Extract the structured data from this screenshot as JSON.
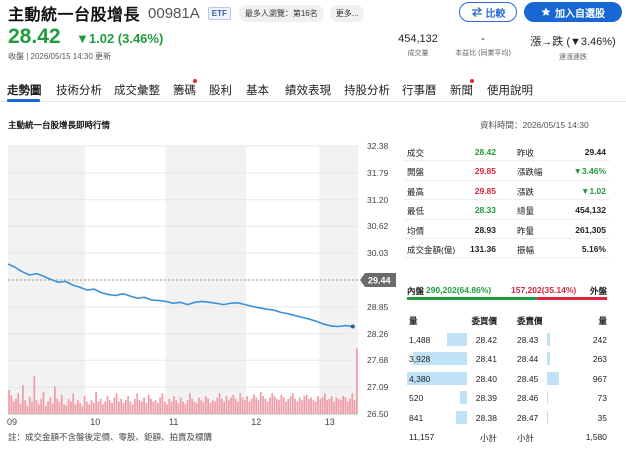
{
  "header": {
    "name": "主動統一台股增長",
    "code": "00981A",
    "etf_tag": "ETF",
    "rank_tag": "最多人瀏覽：第16名",
    "more_tag": "更多...",
    "compare_label": "比較",
    "watch_label": "加入自選股",
    "price": "28.42",
    "change": "▼1.02 (3.46%)",
    "timestamp": "收盤 | 2026/05/15 14:30 更新",
    "stats": [
      {
        "value": "454,132",
        "label": "成交量"
      },
      {
        "value": "-",
        "label": "本益比 (同業平均)"
      },
      {
        "value": "漲→跌 (▼3.46%)",
        "label": "連漲連跌"
      }
    ]
  },
  "tabs": [
    "走勢圖",
    "技術分析",
    "成交彙整",
    "籌碼",
    "股利",
    "基本",
    "績效表現",
    "持股分析",
    "行事曆",
    "新聞",
    "使用說明"
  ],
  "section_title": "主動統一台股增長即時行情",
  "data_time": "資料時間：2026/05/15 14:30",
  "footnote": "註：成交金額不含盤後定價、零股、鉅額、拍賣及標購",
  "colors": {
    "up": "#d7263d",
    "down": "#1f9c3d",
    "line": "#3d8fd8",
    "accent": "#1967d2",
    "volume": "#ef9aa5"
  },
  "chart_data": {
    "type": "line",
    "title": "",
    "x_ticks": [
      "09",
      "10",
      "11",
      "12",
      "13"
    ],
    "y_ticks": [
      "32.38",
      "31.79",
      "31.20",
      "30.62",
      "30.03",
      "29.44",
      "28.85",
      "28.26",
      "27.68",
      "27.09",
      "26.50"
    ],
    "ylim": [
      26.5,
      32.38
    ],
    "reference_price": 29.44,
    "reference_label": "29.44",
    "series": [
      {
        "values": [
          29.79,
          29.72,
          29.62,
          29.55,
          29.58,
          29.52,
          29.45,
          29.39,
          29.41,
          29.33,
          29.28,
          29.22,
          29.24,
          29.16,
          29.12,
          29.1,
          29.14,
          29.09,
          29.04,
          29.06,
          29.0,
          28.99,
          28.97,
          28.93,
          28.95,
          28.9,
          28.95,
          28.97,
          28.95,
          28.93,
          28.9,
          28.93,
          28.94,
          28.9,
          28.86,
          28.83,
          28.8,
          28.78,
          28.73,
          28.7,
          28.66,
          28.62,
          28.58,
          28.53,
          28.47,
          28.43,
          28.42,
          28.44,
          28.42
        ]
      }
    ],
    "volume": [
      0.35,
      0.27,
      0.18,
      0.22,
      0.3,
      0.15,
      0.42,
      0.2,
      0.12,
      0.25,
      0.18,
      0.55,
      0.2,
      0.14,
      0.22,
      0.32,
      0.12,
      0.18,
      0.24,
      0.15,
      0.4,
      0.22,
      0.18,
      0.28,
      0.14,
      0.12,
      0.22,
      0.18,
      0.3,
      0.14,
      0.2,
      0.16,
      0.12,
      0.26,
      0.18,
      0.14,
      0.2,
      0.16,
      0.32,
      0.18,
      0.22,
      0.14,
      0.18,
      0.26,
      0.2,
      0.16,
      0.24,
      0.3,
      0.18,
      0.22,
      0.16,
      0.2,
      0.26,
      0.18,
      0.14,
      0.22,
      0.3,
      0.2,
      0.18,
      0.24,
      0.16,
      0.28,
      0.22,
      0.18,
      0.2,
      0.16,
      0.24,
      0.3,
      0.18,
      0.14,
      0.22,
      0.18,
      0.26,
      0.2,
      0.16,
      0.24,
      0.18,
      0.14,
      0.2,
      0.3,
      0.22,
      0.18,
      0.16,
      0.24,
      0.2,
      0.18,
      0.26,
      0.22,
      0.16,
      0.2,
      0.18,
      0.24,
      0.3,
      0.22,
      0.18,
      0.26,
      0.2,
      0.24,
      0.28,
      0.22,
      0.18,
      0.3,
      0.24,
      0.2,
      0.26,
      0.18,
      0.22,
      0.28,
      0.24,
      0.2,
      0.32,
      0.26,
      0.22,
      0.18,
      0.24,
      0.3,
      0.26,
      0.22,
      0.2,
      0.28,
      0.24,
      0.18,
      0.22,
      0.26,
      0.3,
      0.22,
      0.18,
      0.24,
      0.2,
      0.26,
      0.28,
      0.22,
      0.24,
      0.2,
      0.18,
      0.26,
      0.22,
      0.24,
      0.3,
      0.2,
      0.22,
      0.26,
      0.18,
      0.24,
      0.22,
      0.2,
      0.26,
      0.24,
      0.18,
      0.22,
      0.3,
      0.2,
      0.95
    ]
  },
  "stats_table": [
    [
      {
        "label": "成交",
        "value": "28.42",
        "cls": "green"
      },
      {
        "label": "昨收",
        "value": "29.44",
        "cls": ""
      }
    ],
    [
      {
        "label": "開盤",
        "value": "29.85",
        "cls": "red"
      },
      {
        "label": "漲跌幅",
        "value": "▼3.46%",
        "cls": "green"
      }
    ],
    [
      {
        "label": "最高",
        "value": "29.85",
        "cls": "red"
      },
      {
        "label": "漲跌",
        "value": "▼1.02",
        "cls": "green"
      }
    ],
    [
      {
        "label": "最低",
        "value": "28.33",
        "cls": "green"
      },
      {
        "label": "總量",
        "value": "454,132",
        "cls": ""
      }
    ],
    [
      {
        "label": "均價",
        "value": "28.93",
        "cls": ""
      },
      {
        "label": "昨量",
        "value": "261,305",
        "cls": ""
      }
    ],
    [
      {
        "label": "成交金額(億)",
        "value": "131.36",
        "cls": ""
      },
      {
        "label": "振幅",
        "value": "5.16%",
        "cls": ""
      }
    ]
  ],
  "ratio": {
    "in_label": "內盤",
    "in_value": "290,202(64.86%)",
    "out_value": "157,202(35.14%)",
    "out_label": "外盤",
    "in_pct": 64.86
  },
  "order_book": {
    "bid_headers": [
      "量",
      "委買價"
    ],
    "ask_headers": [
      "委賣價",
      "量"
    ],
    "bids": [
      {
        "qty": "1,488",
        "price": "28.42",
        "ratio": 0.34
      },
      {
        "qty": "3,928",
        "price": "28.41",
        "ratio": 0.9
      },
      {
        "qty": "4,380",
        "price": "28.40",
        "ratio": 1.0
      },
      {
        "qty": "520",
        "price": "28.39",
        "ratio": 0.12
      },
      {
        "qty": "841",
        "price": "28.38",
        "ratio": 0.19
      }
    ],
    "asks": [
      {
        "price": "28.43",
        "qty": "242",
        "ratio": 0.25
      },
      {
        "price": "28.44",
        "qty": "263",
        "ratio": 0.27
      },
      {
        "price": "28.45",
        "qty": "967",
        "ratio": 1.0
      },
      {
        "price": "28.46",
        "qty": "73",
        "ratio": 0.08
      },
      {
        "price": "28.47",
        "qty": "35",
        "ratio": 0.04
      }
    ],
    "bid_total": "11,157",
    "bid_total_label": "小計",
    "ask_total_label": "小計",
    "ask_total": "1,580"
  }
}
